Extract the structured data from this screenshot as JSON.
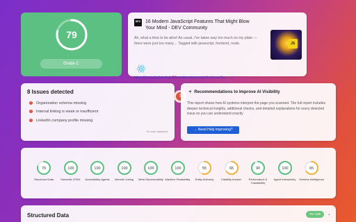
{
  "grade": {
    "score": "79",
    "score_value": 79,
    "label": "Grade C",
    "color": "#5bc081"
  },
  "article": {
    "source_logo": "DEV",
    "title": "16 Modern JavaScript Features That Might Blow Your Mind - DEV Community",
    "description": "Ah, what a time to be alive! As usual, I've taken way too much on my plate — there were just too many… Tagged with javascript, frontend, node.",
    "url": "https://dev.to/sylwia-lask/16-modern-javascript-features-tha…",
    "thumbnail_badge": "JS",
    "icon": "react-icon",
    "link_icon": "external-link-icon"
  },
  "issues": {
    "title": "8 Issues detected",
    "alert_symbol": "!",
    "items": [
      {
        "label": "Organization schema missing",
        "icon": "!"
      },
      {
        "label": "Internal linking is weak or insufficient",
        "icon": "!"
      },
      {
        "label": "LinkedIn company profile missing",
        "icon": "!"
      }
    ],
    "more_label": "+5 more detected",
    "accent_color": "#e24a3b"
  },
  "recommendations": {
    "title": "Recommendations to Improve AI Visibility",
    "icon": "sparkle-icon",
    "body": "This report shows how AI systems interpret the page you scanned. The full report includes deeper technical insights, additional checks, and detailed explanations for every detected issue so you can understand exactly",
    "button_label": "→ Need Help Improving?",
    "button_color": "#1f5fd6"
  },
  "metrics": [
    {
      "score": "79",
      "value": 79,
      "label": "Structured Data",
      "color": "#5bc081"
    },
    {
      "score": "100",
      "value": 100,
      "label": "Semantic HTML",
      "color": "#5bc081"
    },
    {
      "score": "100",
      "value": 100,
      "label": "Accessibility Agents",
      "color": "#5bc081"
    },
    {
      "score": "100",
      "value": 100,
      "label": "Internal Linking",
      "color": "#5bc081"
    },
    {
      "score": "100",
      "value": 100,
      "label": "Meta Discoverability",
      "color": "#5bc081"
    },
    {
      "score": "100",
      "value": 100,
      "label": "Machine Readability",
      "color": "#5bc081"
    },
    {
      "score": "55",
      "value": 55,
      "label": "Entity Authority",
      "color": "#f2b33d"
    },
    {
      "score": "65",
      "value": 65,
      "label": "Citability Answer",
      "color": "#f2b33d"
    },
    {
      "score": "90",
      "value": 90,
      "label": "Performance & Crawlability",
      "color": "#5bc081"
    },
    {
      "score": "100",
      "value": 100,
      "label": "Agent Interactivity",
      "color": "#5bc081"
    },
    {
      "score": "65",
      "value": 65,
      "label": "Schema Intelligence",
      "color": "#f2b33d"
    }
  ],
  "structured_data": {
    "title": "Structured Data",
    "pill": "79 / 100",
    "chevron": "⌄"
  }
}
